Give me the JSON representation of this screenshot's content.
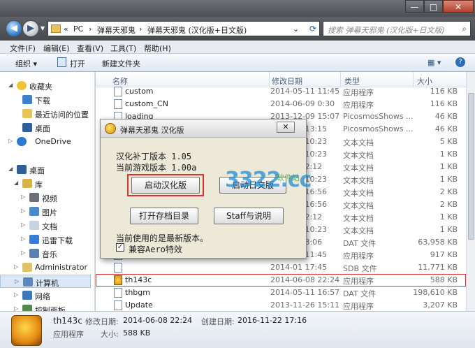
{
  "window": {
    "controls": {
      "minimize": "—",
      "maximize": "□",
      "close": "✕"
    }
  },
  "address": {
    "crumbs": [
      "«",
      "PC",
      "›",
      "弹幕天邪鬼",
      "›",
      "弹幕天邪鬼 (汉化版+日文版)",
      "⌄"
    ],
    "search_placeholder": "搜索 弹幕天邪鬼 (汉化版+日文版)"
  },
  "menu": [
    "文件(F)",
    "编辑(E)",
    "查看(V)",
    "工具(T)",
    "帮助(H)"
  ],
  "toolbar": {
    "organize": "组织 ▾",
    "open": "打开",
    "new_folder": "新建文件夹"
  },
  "nav": [
    {
      "label": "收藏夹",
      "icon": "star-icon"
    },
    {
      "label": "下载",
      "icon": "download-folder-icon"
    },
    {
      "label": "最近访问的位置",
      "icon": "recent-icon"
    },
    {
      "label": "桌面",
      "icon": "desktop-icon"
    },
    {
      "label": "OneDrive",
      "icon": "cloud-icon"
    },
    {
      "label": "桌面",
      "icon": "desktop-icon"
    },
    {
      "label": "库",
      "icon": "library-icon"
    },
    {
      "label": "视频",
      "icon": "video-icon"
    },
    {
      "label": "图片",
      "icon": "picture-icon"
    },
    {
      "label": "文档",
      "icon": "document-icon"
    },
    {
      "label": "迅雷下载",
      "icon": "thunder-icon"
    },
    {
      "label": "音乐",
      "icon": "music-icon"
    },
    {
      "label": "Administrator",
      "icon": "user-folder-icon"
    },
    {
      "label": "计算机",
      "icon": "computer-icon"
    },
    {
      "label": "网络",
      "icon": "network-icon"
    },
    {
      "label": "控制面板",
      "icon": "control-panel-icon"
    }
  ],
  "columns": {
    "name": "名称",
    "date": "修改日期",
    "type": "类型",
    "size": "大小"
  },
  "files": [
    {
      "name": "custom",
      "date": "2014-05-11 11:45",
      "type": "应用程序",
      "size": "116 KB"
    },
    {
      "name": "custom_CN",
      "date": "2014-06-09 0:30",
      "type": "应用程序",
      "size": "116 KB"
    },
    {
      "name": "loading",
      "date": "2013-12-09 15:07",
      "type": "PicosmosShows ...",
      "size": "46 KB"
    },
    {
      "name": "",
      "date": "2014-04 13:15",
      "type": "PicosmosShows ...",
      "size": "46 KB"
    },
    {
      "name": "",
      "date": "2014-01 10:23",
      "type": "文本文档",
      "size": "5 KB"
    },
    {
      "name": "",
      "date": "2014-01 10:23",
      "type": "文本文档",
      "size": "1 KB"
    },
    {
      "name": "",
      "date": "2014-01 2:12",
      "type": "文本文档",
      "size": "1 KB"
    },
    {
      "name": "",
      "date": "2014-01 10:23",
      "type": "文本文档",
      "size": "1 KB"
    },
    {
      "name": "",
      "date": "2014-01 16:56",
      "type": "文本文档",
      "size": "2 KB"
    },
    {
      "name": "",
      "date": "2014-01 16:56",
      "type": "文本文档",
      "size": "2 KB"
    },
    {
      "name": "",
      "date": "2014-01 2:12",
      "type": "文本文档",
      "size": "1 KB"
    },
    {
      "name": "",
      "date": "2014-01 10:23",
      "type": "文本文档",
      "size": "1 KB"
    },
    {
      "name": "",
      "date": "2014-01 3:06",
      "type": "DAT 文件",
      "size": "63,958 KB"
    },
    {
      "name": "",
      "date": "2014-01 11:45",
      "type": "应用程序",
      "size": "917 KB"
    },
    {
      "name": "",
      "date": "2014-01 17:45",
      "type": "SDB 文件",
      "size": "11,771 KB"
    },
    {
      "name": "th143c",
      "date": "2014-06-08 22:24",
      "type": "应用程序",
      "size": "588 KB"
    },
    {
      "name": "thbgm",
      "date": "2014-05-11 16:57",
      "type": "DAT 文件",
      "size": "198,610 KB"
    },
    {
      "name": "Update",
      "date": "2013-11-26 15:11",
      "type": "应用程序",
      "size": "3,207 KB"
    }
  ],
  "details": {
    "name": "th143c",
    "kind": "应用程序",
    "modified_label": "修改日期:",
    "modified": "2014-06-08 22:24",
    "created_label": "创建日期:",
    "created": "2016-11-22 17:16",
    "size_label": "大小:",
    "size": "588 KB"
  },
  "dialog": {
    "title": "弹幕天邪鬼 汉化版",
    "close": "✕",
    "patch_version": "汉化补丁版本  1.05",
    "game_version": "当前游戏版本  1.00a",
    "btn_start_cn": "启动汉化版",
    "btn_start_jp": "启动日文版",
    "btn_open_save": "打开存档目录",
    "btn_staff": "Staff与说明",
    "status": "当前使用的是最新版本。",
    "aero_label": "兼容Aero特效",
    "aero_checked": "✓"
  },
  "watermark": {
    "text": "3322.cc",
    "sub": "软件站"
  }
}
